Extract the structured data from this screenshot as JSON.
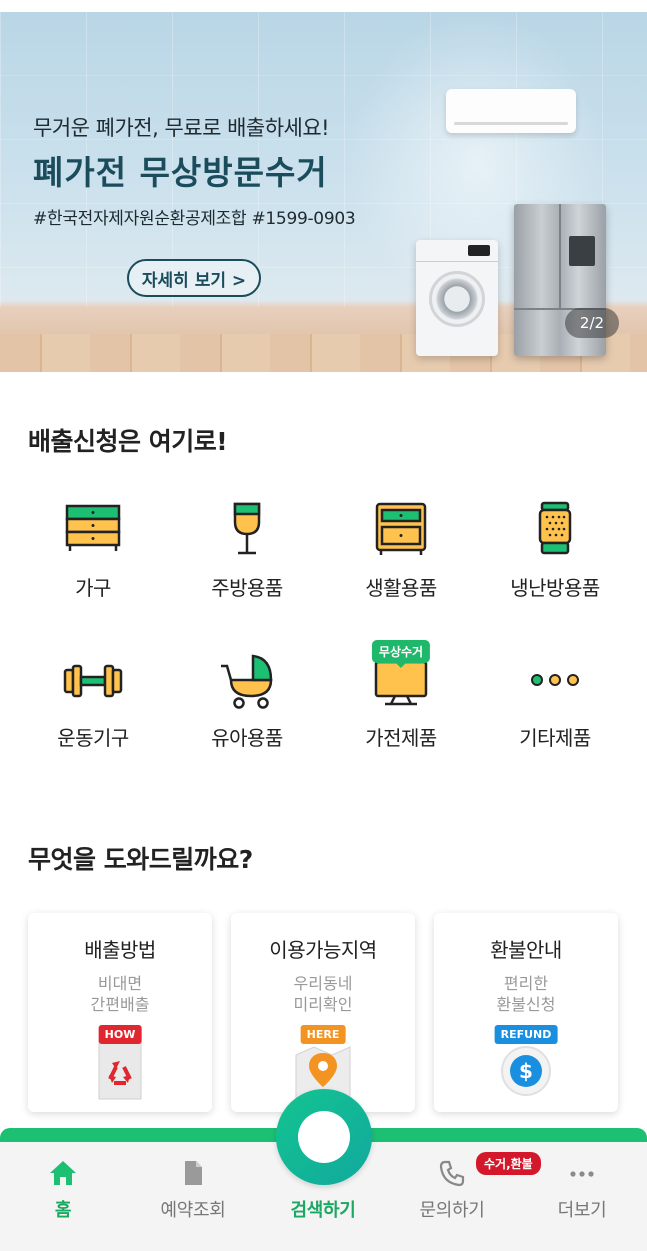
{
  "banner": {
    "subtitle": "무거운 폐가전, 무료로 배출하세요!",
    "title": "폐가전 무상방문수거",
    "tags": "#한국전자제자원순환공제조합 #1599-0903",
    "button_label": "자세히 보기 >",
    "pager": "2/2"
  },
  "categories": {
    "title": "배출신청은 여기로!",
    "items": [
      {
        "label": "가구",
        "icon": "furniture-drawer-icon"
      },
      {
        "label": "주방용품",
        "icon": "wine-glass-icon"
      },
      {
        "label": "생활용품",
        "icon": "cabinet-icon"
      },
      {
        "label": "냉난방용품",
        "icon": "heater-icon"
      },
      {
        "label": "운동기구",
        "icon": "dumbbell-icon"
      },
      {
        "label": "유아용품",
        "icon": "stroller-icon"
      },
      {
        "label": "가전제품",
        "icon": "tv-monitor-icon",
        "badge": "무상수거"
      },
      {
        "label": "기타제품",
        "icon": "more-dots-icon"
      }
    ]
  },
  "help": {
    "title": "무엇을 도와드릴까요?",
    "cards": [
      {
        "title": "배출방법",
        "desc": "비대면\n간편배출",
        "tag": "HOW",
        "icon": "recycle-icon"
      },
      {
        "title": "이용가능지역",
        "desc": "우리동네\n미리확인",
        "tag": "HERE",
        "icon": "map-pin-icon"
      },
      {
        "title": "환불안내",
        "desc": "편리한\n환불신청",
        "tag": "REFUND",
        "icon": "dollar-coin-icon"
      }
    ]
  },
  "nav": {
    "home": "홈",
    "reservations": "예약조회",
    "search": "검색하기",
    "inquiry": "문의하기",
    "inquiry_badge": "수거,환불",
    "more": "더보기"
  },
  "colors": {
    "brand_green": "#1dbf73",
    "accent_yellow": "#ffc34d",
    "badge_red": "#d3182b",
    "banner_title": "#1a4c5c"
  }
}
